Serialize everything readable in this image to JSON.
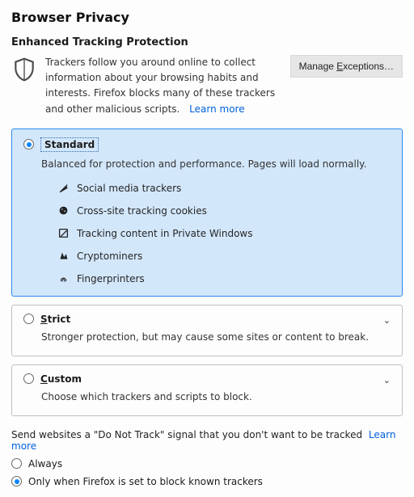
{
  "page_title": "Browser Privacy",
  "section_title": "Enhanced Tracking Protection",
  "intro_text": "Trackers follow you around online to collect information about your browsing habits and interests. Firefox blocks many of these trackers and other malicious scripts.",
  "learn_more": "Learn more",
  "manage_exceptions": "Manage Exceptions…",
  "options": {
    "standard": {
      "label": "Standard",
      "desc": "Balanced for protection and performance. Pages will load normally.",
      "trackers": [
        "Social media trackers",
        "Cross-site tracking cookies",
        "Tracking content in Private Windows",
        "Cryptominers",
        "Fingerprinters"
      ]
    },
    "strict": {
      "label": "Strict",
      "desc": "Stronger protection, but may cause some sites or content to break."
    },
    "custom": {
      "label": "Custom",
      "desc": "Choose which trackers and scripts to block."
    }
  },
  "dnt": {
    "prompt": "Send websites a \"Do Not Track\" signal that you don't want to be tracked",
    "always": "Always",
    "only_when": "Only when Firefox is set to block known trackers"
  }
}
